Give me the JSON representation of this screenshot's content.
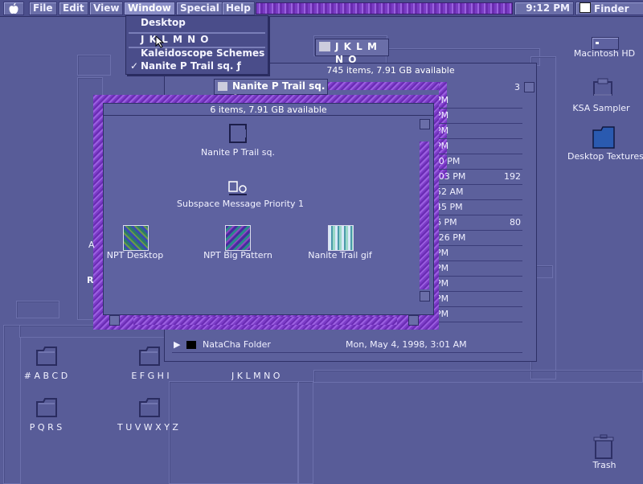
{
  "menubar": {
    "apple": "",
    "items": [
      "File",
      "Edit",
      "View",
      "Window",
      "Special",
      "Help"
    ],
    "clock": "9:12 PM",
    "app": "Finder"
  },
  "window_menu": {
    "items": [
      "Desktop",
      "J K L M N O",
      "Kaleidoscope Schemes",
      "Nanite P Trail sq. ƒ"
    ],
    "checked_item": "Nanite P Trail sq. ƒ",
    "check_mark": "✓"
  },
  "desktop_icons": [
    {
      "label": "Macintosh HD"
    },
    {
      "label": "KSA Sampler"
    },
    {
      "label": "Desktop Textures"
    },
    {
      "label": "Trash"
    }
  ],
  "desktop_folders": [
    {
      "label": "# A B C D"
    },
    {
      "label": "E F G H I"
    },
    {
      "label": "J K L M N O"
    },
    {
      "label": "P Q R S"
    },
    {
      "label": "T U V W X Y Z"
    }
  ],
  "jklmno_window": {
    "title": "J K L M N O",
    "status": "745 items, 7.91 GB available",
    "list_times": [
      "PM",
      "PM",
      "PM",
      "PM",
      ":0 PM",
      ":03 PM",
      "52 AM",
      "45 PM",
      "6 PM",
      ":26 PM",
      "PM",
      "PM",
      "PM",
      "PM",
      "PM"
    ],
    "list_sizes": [
      "",
      "",
      "",
      "",
      "",
      "192",
      "",
      "",
      "80",
      "",
      "",
      "",
      "",
      "",
      ""
    ],
    "bottom_row": {
      "name": "NataCha Folder",
      "date": "Mon, May 4, 1998, 3:01 AM"
    },
    "scroll_value": "3"
  },
  "nanite_window": {
    "tab_title": "Nanite P Trail sq. ƒ",
    "status": "6 items, 7.91 GB available",
    "items": [
      {
        "label": "Nanite P Trail sq."
      },
      {
        "label": "Subspace Message Priority 1"
      },
      {
        "label": "NPT Desktop"
      },
      {
        "label": "NPT Big Pattern"
      },
      {
        "label": "Nanite Trail gif"
      }
    ]
  },
  "partial_text": {
    "a": "A",
    "r": "R"
  },
  "colors": {
    "desktop": "#585c98",
    "accent": "#8a4ad6",
    "menubar": "#4c4f8c"
  }
}
